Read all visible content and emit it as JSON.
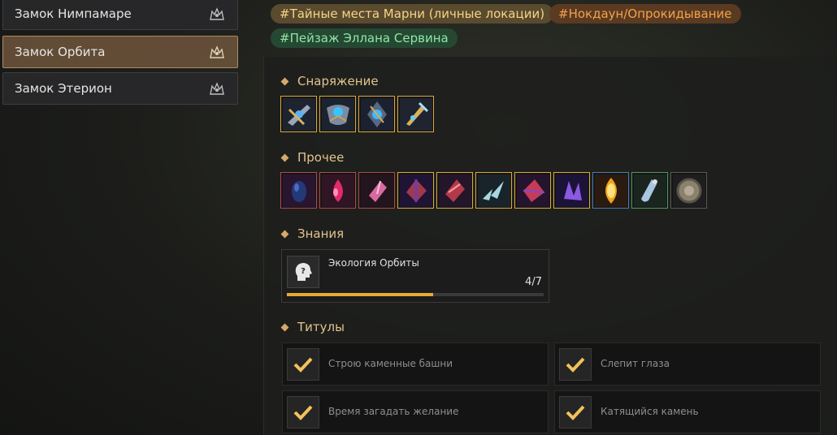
{
  "sidebar": {
    "items": [
      {
        "label": "Замок Нимпамаре",
        "icon": "castle-crown-icon",
        "active": false
      },
      {
        "label": "Замок Орбита",
        "icon": "castle-crown-icon",
        "active": true
      },
      {
        "label": "Замок Этерион",
        "icon": "castle-crown-icon",
        "active": false
      }
    ]
  },
  "tags": [
    {
      "label": "#Тайные места Марни (личные локации)",
      "color": "#f4d48a"
    },
    {
      "label": "#Нокдаун/Опрокидывание",
      "color": "#f2a24a"
    },
    {
      "label": "#Пейзаж Эллана Сервина",
      "color": "#8ee6a4"
    }
  ],
  "sections": {
    "equipment": {
      "title": "Снаряжение",
      "items": [
        "crossbow-artifact-icon",
        "blue-gem-armor-icon",
        "blue-gem-amulet-icon",
        "golden-weapon-icon"
      ]
    },
    "misc": {
      "title": "Прочее",
      "items": [
        "dark-blue-stone-icon",
        "red-gem-icon",
        "pink-crystal-icon",
        "purple-crystal-icon",
        "red-crystal-icon",
        "ice-shards-icon",
        "red-purple-crystal-icon",
        "violet-crystal-icon",
        "golden-gem-icon",
        "potion-flask-icon",
        "round-shield-icon"
      ]
    },
    "knowledge": {
      "title": "Знания",
      "entry": {
        "name": "Экология Орбиты",
        "count": "4/7",
        "progress": 0.571,
        "icon": "head-question-icon"
      }
    },
    "titles": {
      "title": "Титулы",
      "items": [
        {
          "name": "Строю каменные башни",
          "icon": "check-icon"
        },
        {
          "name": "Слепит глаза",
          "icon": "check-icon"
        },
        {
          "name": "Время загадать желание",
          "icon": "check-icon"
        },
        {
          "name": "Катящийся камень",
          "icon": "check-icon"
        }
      ]
    }
  },
  "colors": {
    "accent": "#e2c48c",
    "progress": "#e7a933",
    "active_item": "#6e553c"
  }
}
